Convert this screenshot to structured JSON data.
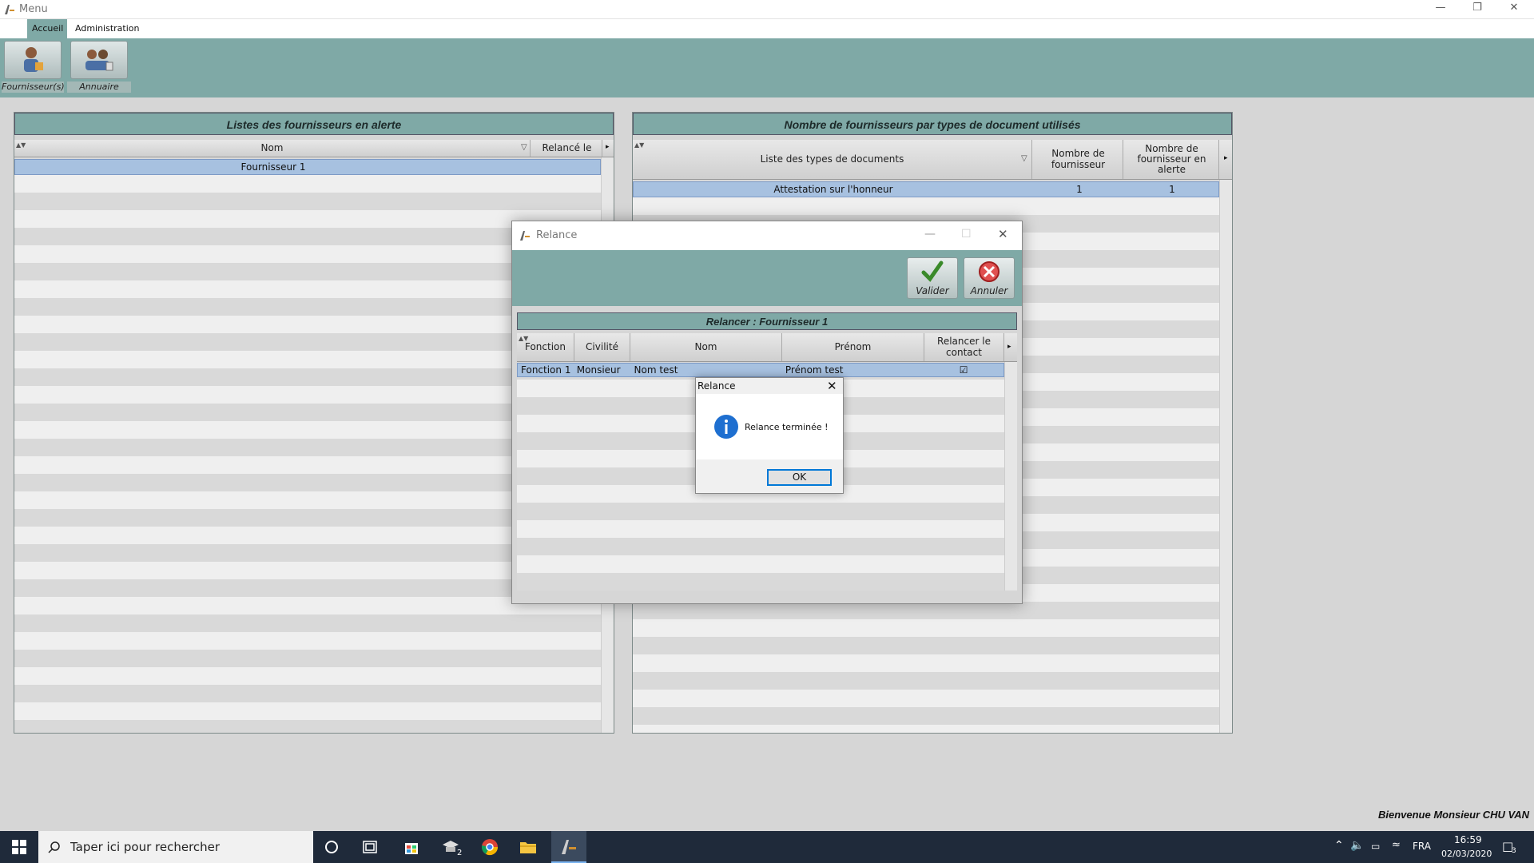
{
  "window": {
    "title": "Menu"
  },
  "tabs": {
    "accueil": "Accueil",
    "administration": "Administration"
  },
  "ribbon": {
    "fournisseurs": "Fournisseur(s)",
    "annuaire": "Annuaire"
  },
  "left_panel": {
    "title": "Listes des fournisseurs en alerte",
    "columns": [
      "Nom",
      "Relancé le"
    ],
    "rows": [
      {
        "nom": "Fournisseur 1",
        "relance_le": ""
      }
    ]
  },
  "right_panel": {
    "title": "Nombre de fournisseurs par types de document utilisés",
    "columns": [
      "Liste des types de documents",
      "Nombre de fournisseur",
      "Nombre de fournisseur en alerte"
    ],
    "rows": [
      {
        "type": "Attestation sur l'honneur",
        "nombre": "1",
        "alerte": "1"
      }
    ]
  },
  "relance_dialog": {
    "title": "Relance",
    "valider": "Valider",
    "annuler": "Annuler",
    "section_title": "Relancer : Fournisseur 1",
    "columns": [
      "Fonction",
      "Civilité",
      "Nom",
      "Prénom",
      "Relancer le contact"
    ],
    "rows": [
      {
        "fonction": "Fonction 1",
        "civilite": "Monsieur",
        "nom": "Nom test",
        "prenom": "Prénom test",
        "relancer": true
      }
    ]
  },
  "message_box": {
    "title": "Relance",
    "text": "Relance terminée !",
    "ok": "OK"
  },
  "status": {
    "welcome": "Bienvenue Monsieur CHU VAN"
  },
  "taskbar": {
    "search_placeholder": "Taper ici pour rechercher",
    "language": "FRA",
    "time": "16:59",
    "date": "02/03/2020",
    "notification_count": "3",
    "app_badge": "2"
  },
  "colors": {
    "ribbon": "#7fa9a6",
    "selection": "#a7c1e0",
    "taskbar": "#1f2a3a",
    "accent": "#0078d7"
  }
}
